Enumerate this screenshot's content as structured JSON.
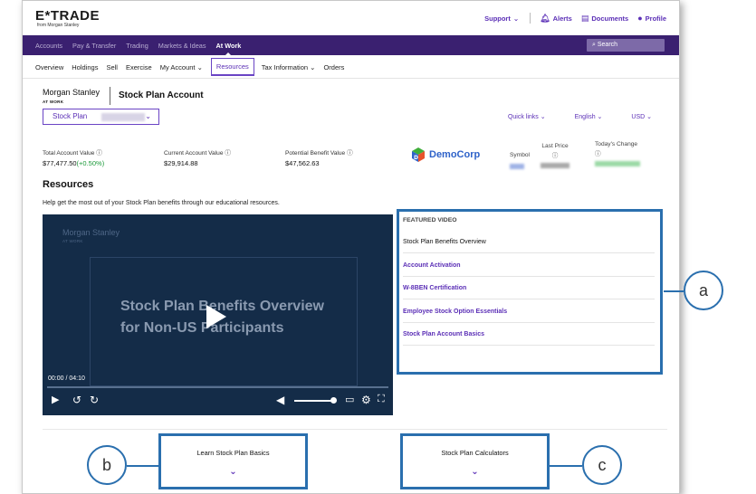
{
  "header": {
    "logo": "E*TRADE",
    "logo_sub": "from Morgan Stanley",
    "support": "Support",
    "alerts": "Alerts",
    "documents": "Documents",
    "profile": "Profile"
  },
  "nav": {
    "items": [
      "Accounts",
      "Pay & Transfer",
      "Trading",
      "Markets & Ideas",
      "At Work"
    ],
    "search": "Search"
  },
  "subnav": {
    "items": [
      "Overview",
      "Holdings",
      "Sell",
      "Exercise",
      "My Account",
      "Resources",
      "Tax Information",
      "Orders"
    ]
  },
  "account": {
    "ms_name": "Morgan Stanley",
    "ms_sub": "AT WORK",
    "title": "Stock Plan Account",
    "plan_select": "Stock Plan",
    "quick_links": "Quick links",
    "language": "English",
    "currency": "USD"
  },
  "values": {
    "total_label": "Total Account Value",
    "total_value": "$77,477.50",
    "total_change": "(+0.50%)",
    "current_label": "Current Account Value",
    "current_value": "$29,914.88",
    "potential_label": "Potential Benefit Value",
    "potential_value": "$47,562.63"
  },
  "company": {
    "name": "DemoCorp",
    "symbol_label": "Symbol",
    "price_label": "Last Price",
    "change_label": "Today's Change"
  },
  "resources": {
    "title": "Resources",
    "description": "Help get the most out of your Stock Plan benefits through our educational resources."
  },
  "video": {
    "ms_name": "Morgan Stanley",
    "ms_sub": "AT WORK",
    "title_line1": "Stock Plan Benefits Overview",
    "title_line2": "for Non-US Participants",
    "time": "00:00 / 04:10"
  },
  "featured": {
    "heading": "FEATURED VIDEO",
    "items": [
      "Stock Plan Benefits Overview",
      "Account Activation",
      "W-8BEN Certification",
      "Employee Stock Option Essentials",
      "Stock Plan Account Basics"
    ]
  },
  "bottom": {
    "learn": "Learn Stock Plan Basics",
    "calculators": "Stock Plan Calculators"
  },
  "callouts": [
    "a",
    "b",
    "c"
  ],
  "colors": {
    "brand_purple": "#5b2fb6",
    "nav_bg": "#3a2070",
    "highlight_blue": "#2a6fae",
    "positive_green": "#1c9a3a"
  }
}
